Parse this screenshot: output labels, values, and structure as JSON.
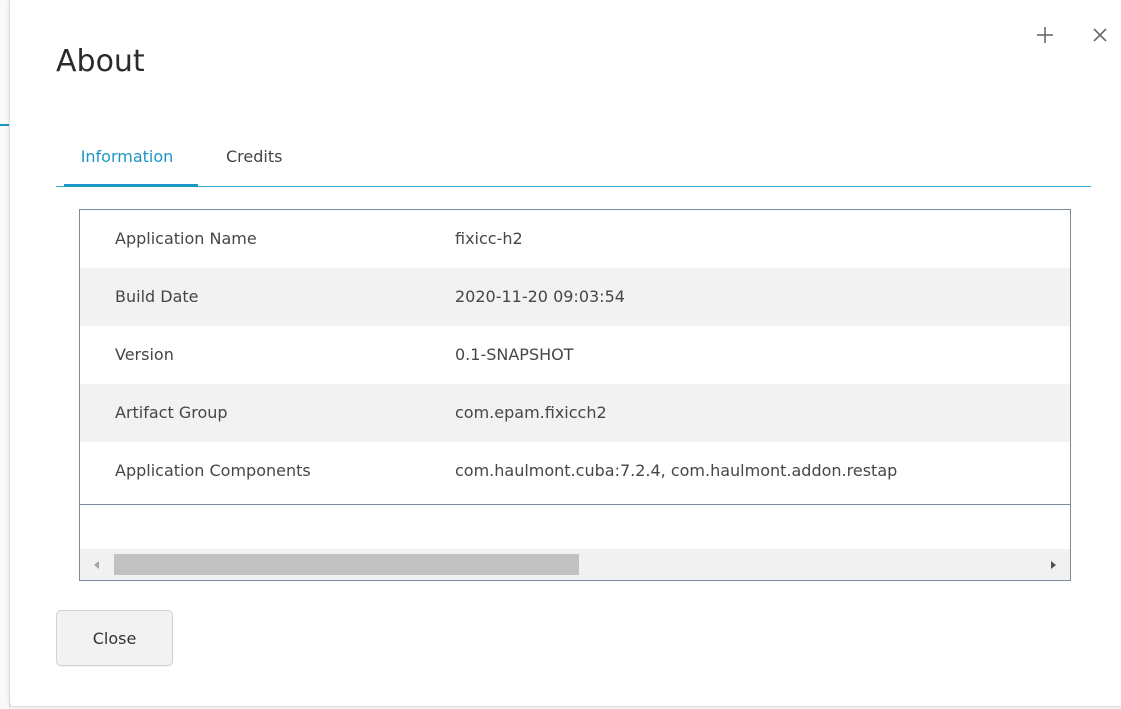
{
  "dialog": {
    "title": "About"
  },
  "tabs": [
    {
      "label": "Information",
      "active": true
    },
    {
      "label": "Credits",
      "active": false
    }
  ],
  "info_table": {
    "rows": [
      {
        "key": "Application Name",
        "value": "fixicc-h2"
      },
      {
        "key": "Build Date",
        "value": "2020-11-20 09:03:54"
      },
      {
        "key": "Version",
        "value": "0.1-SNAPSHOT"
      },
      {
        "key": "Artifact Group",
        "value": "com.epam.fixicch2"
      },
      {
        "key": "Application Components",
        "value": "com.haulmont.cuba:7.2.4, com.haulmont.addon.restap"
      }
    ]
  },
  "footer": {
    "close_label": "Close"
  },
  "colors": {
    "accent": "#1c96c5",
    "row_alt": "#f2f2f2",
    "border": "#7d8a97"
  },
  "icons": {
    "maximize": "plus-icon",
    "close": "close-icon",
    "scroll_left": "scroll-left-arrow-icon",
    "scroll_right": "scroll-right-arrow-icon"
  }
}
